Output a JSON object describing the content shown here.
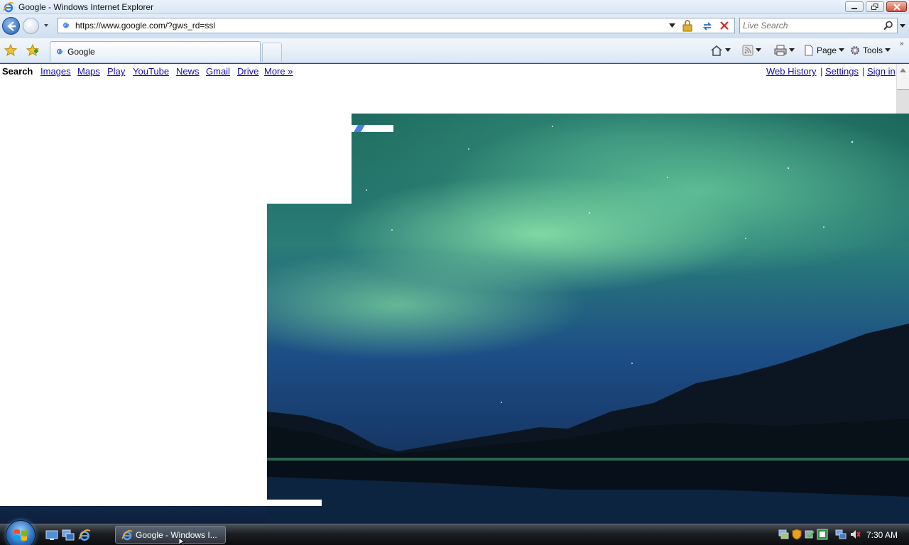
{
  "window": {
    "title": "Google - Windows Internet Explorer"
  },
  "address_bar": {
    "url": "https://www.google.com/?gws_rd=ssl"
  },
  "search_box": {
    "placeholder": "Live Search"
  },
  "tabs": [
    {
      "label": "Google",
      "active": true
    }
  ],
  "command_bar": {
    "page_label": "Page",
    "tools_label": "Tools"
  },
  "google_bar": {
    "left_links": [
      "Search",
      "Images",
      "Maps",
      "Play",
      "YouTube",
      "News",
      "Gmail",
      "Drive",
      "More »"
    ],
    "active_link": "Search",
    "right_links": [
      "Web History",
      "Settings",
      "Sign in"
    ],
    "separator": "|"
  },
  "taskbar": {
    "task_button_label": "Google - Windows I...",
    "clock": "7:30 AM"
  },
  "colors": {
    "link": "#1a0dab",
    "title_bar": "#d8e6f5",
    "taskbar": "#1b1e22"
  }
}
